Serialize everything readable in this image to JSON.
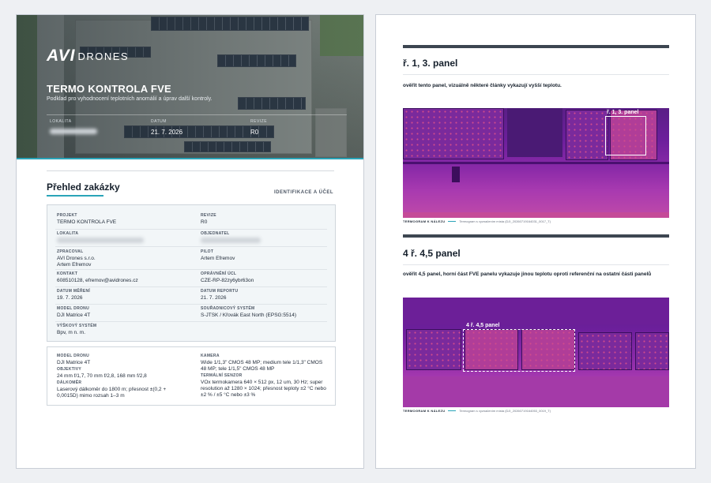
{
  "cover": {
    "logo_mark": "AVI",
    "logo_word": "DRONES",
    "title": "TERMO KONTROLA FVE",
    "subtitle": "Podklad pro vyhodnocení teplotních anomálií a úprav další kontroly.",
    "meta": [
      {
        "label": "LOKALITA",
        "value": ""
      },
      {
        "label": "DATUM",
        "value": "21. 7. 2026"
      },
      {
        "label": "REVIZE",
        "value": "R0"
      }
    ]
  },
  "overview": {
    "title": "Přehled zakázky",
    "tag": "IDENTIFIKACE A ÚČEL",
    "fields": {
      "projekt": {
        "label": "PROJEKT",
        "value": "TERMO KONTROLA FVE"
      },
      "revize": {
        "label": "REVIZE",
        "value": "R0"
      },
      "lokalita": {
        "label": "LOKALITA",
        "value": ""
      },
      "objednatel": {
        "label": "OBJEDNATEL",
        "value": ""
      },
      "zpracoval": {
        "label": "ZPRACOVAL",
        "line1": "AVI Drones s.r.o.",
        "line2": "Artem Efremov"
      },
      "pilot": {
        "label": "PILOT",
        "value": "Artem Efremov"
      },
      "kontakt": {
        "label": "KONTAKT",
        "value": "608510128, efremov@avidrones.cz"
      },
      "opravneni": {
        "label": "OPRÁVNĚNÍ ÚCL",
        "value": "CZE-RP-82zy6ybr63on"
      },
      "datum_mereni": {
        "label": "DATUM MĚŘENÍ",
        "value": "19. 7. 2026"
      },
      "datum_reportu": {
        "label": "DATUM REPORTU",
        "value": "21. 7. 2026"
      },
      "model_dronu": {
        "label": "MODEL DRONU",
        "value": "DJI Matrice 4T"
      },
      "souradnice": {
        "label": "SOUŘADNICOVÝ SYSTÉM",
        "value": "S-JTSK / Křovák East North (EPSG:5514)"
      },
      "vyskovy": {
        "label": "VÝŠKOVÝ SYSTÉM",
        "value": "Bpv, m n. m."
      }
    }
  },
  "equipment": {
    "model": {
      "label": "MODEL DRONU",
      "value": "DJI Matrice 4T"
    },
    "objektivy": {
      "label": "OBJEKTIVY",
      "value": "24 mm f/1,7, 70 mm f/2,8, 168 mm f/2,8"
    },
    "dalkomer": {
      "label": "DÁLKOMĚR",
      "value": "Laserový dálkoměr do 1800 m; přesnost ±(0,2 + 0,0015D) mimo rozsah 1–3 m"
    },
    "kamera": {
      "label": "KAMERA",
      "value": "Wide 1/1,3\" CMOS 48 MP; medium tele 1/1,3\" CMOS 48 MP; tele 1/1,5\" CMOS 48 MP"
    },
    "termalni": {
      "label": "TERMÁLNÍ SENZOR",
      "value": "VOx termokamera 640 × 512 px, 12 um, 30 Hz; super resolution až 1280 × 1024; přesnost teploty ±2 °C nebo ±2 % / ±5 °C nebo ±3 %"
    }
  },
  "findings": [
    {
      "title": "ř. 1, 3. panel",
      "note": "ověřit tento panel, vizuálně některé články vykazují vyšší teplotu.",
      "overlay_label": "ř. 1, 3. panel",
      "caption_label": "TERMOGRAM K NÁLEZU",
      "caption_text": "Termogram s vyznačením místa (DJI_20260719164031_0017_T)"
    },
    {
      "title": "4 ř. 4,5 panel",
      "note": "ověřit 4,5 panel, horní část FVE panelu vykazuje jinou teplotu oproti referenční na ostatní části panelů",
      "overlay_label": "4 ř. 4,5 panel",
      "caption_label": "TERMOGRAM K NÁLEZU",
      "caption_text": "Termogram s vyznačením místa (DJI_20260719164053_0019_T)"
    }
  ],
  "colors": {
    "accent": "#2aa4b8",
    "section_bar": "#3d4651"
  }
}
